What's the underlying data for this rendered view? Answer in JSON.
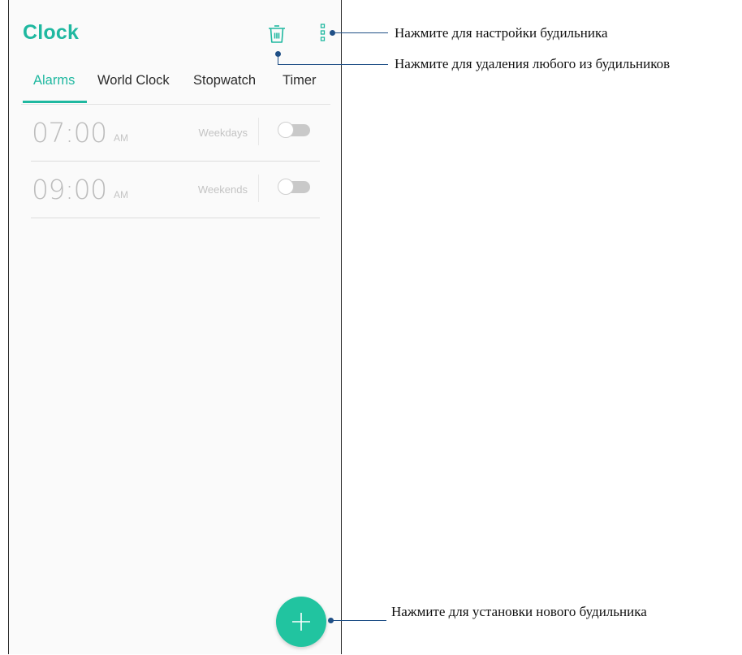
{
  "app": {
    "title": "Clock"
  },
  "toolbar": {
    "delete_icon": "trash-icon",
    "menu_icon": "more-vertical-icon"
  },
  "tabs": [
    {
      "label": "Alarms",
      "active": true
    },
    {
      "label": "World Clock",
      "active": false
    },
    {
      "label": "Stopwatch",
      "active": false
    },
    {
      "label": "Timer",
      "active": false
    }
  ],
  "alarms": [
    {
      "time": "07:00",
      "ampm": "AM",
      "days": "Weekdays",
      "enabled": false
    },
    {
      "time": "09:00",
      "ampm": "AM",
      "days": "Weekends",
      "enabled": false
    }
  ],
  "fab": {
    "icon": "plus-icon"
  },
  "callouts": {
    "settings": "Нажмите для настройки будильника",
    "delete": "Нажмите для удаления любого из будильников",
    "add": "Нажмите для установки нового будильника"
  },
  "colors": {
    "accent": "#1fb8a0",
    "fab": "#21c4a0",
    "callout_line": "#1f4f86"
  }
}
